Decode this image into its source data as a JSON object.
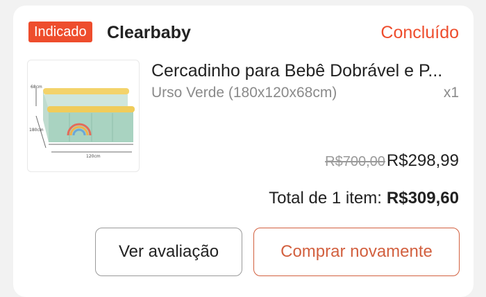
{
  "order": {
    "badge_label": "Indicado",
    "shop_name": "Clearbaby",
    "status": "Concluído",
    "product": {
      "name": "Cercadinho para Bebê Dobrável e P...",
      "variant": "Urso Verde (180x120x68cm)",
      "quantity": "x1",
      "original_price": "R$700,00",
      "price": "R$298,99",
      "image_labels": {
        "height": "68cm",
        "width": "180cm",
        "depth": "120cm"
      }
    },
    "total": {
      "label": "Total de 1 item:",
      "value": "R$309,60"
    },
    "actions": {
      "review_label": "Ver avaliação",
      "buy_again_label": "Comprar novamente"
    }
  },
  "colors": {
    "accent": "#ee4d2d",
    "button_accent": "#d2603f",
    "text_primary": "#222222",
    "text_secondary": "#8a8a8a",
    "background": "#f2f2f2",
    "card": "#ffffff"
  }
}
